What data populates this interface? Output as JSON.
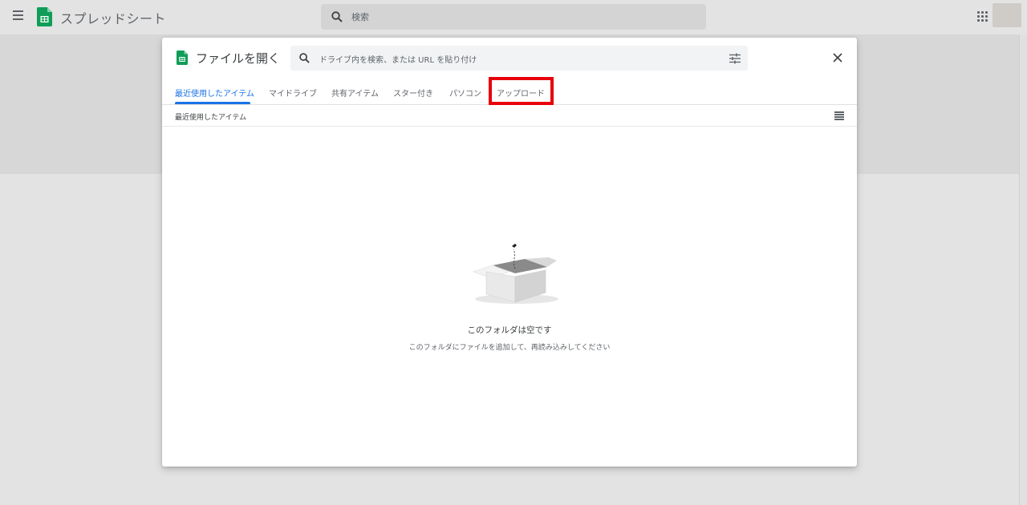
{
  "app": {
    "name": "スプレッドシート",
    "search_placeholder": "検索"
  },
  "dialog": {
    "title": "ファイルを開く",
    "search_placeholder": "ドライブ内を検索、または URL を貼り付け",
    "tabs": [
      {
        "label": "最近使用したアイテム",
        "active": true
      },
      {
        "label": "マイドライブ",
        "active": false
      },
      {
        "label": "共有アイテム",
        "active": false
      },
      {
        "label": "スター付き",
        "active": false
      },
      {
        "label": "パソコン",
        "active": false
      },
      {
        "label": "アップロード",
        "active": false,
        "highlighted": true
      }
    ],
    "breadcrumb": "最近使用したアイテム",
    "empty_title": "このフォルダは空です",
    "empty_subtitle": "このフォルダにファイルを追加して、再読み込みしてください"
  },
  "colors": {
    "accent": "#1a73e8",
    "highlight": "#e8000b",
    "sheets_green": "#0f9d58"
  },
  "icons": [
    "menu-icon",
    "sheets-logo-icon",
    "search-icon",
    "apps-grid-icon",
    "tune-icon",
    "close-icon",
    "list-view-icon",
    "empty-box-illustration"
  ]
}
